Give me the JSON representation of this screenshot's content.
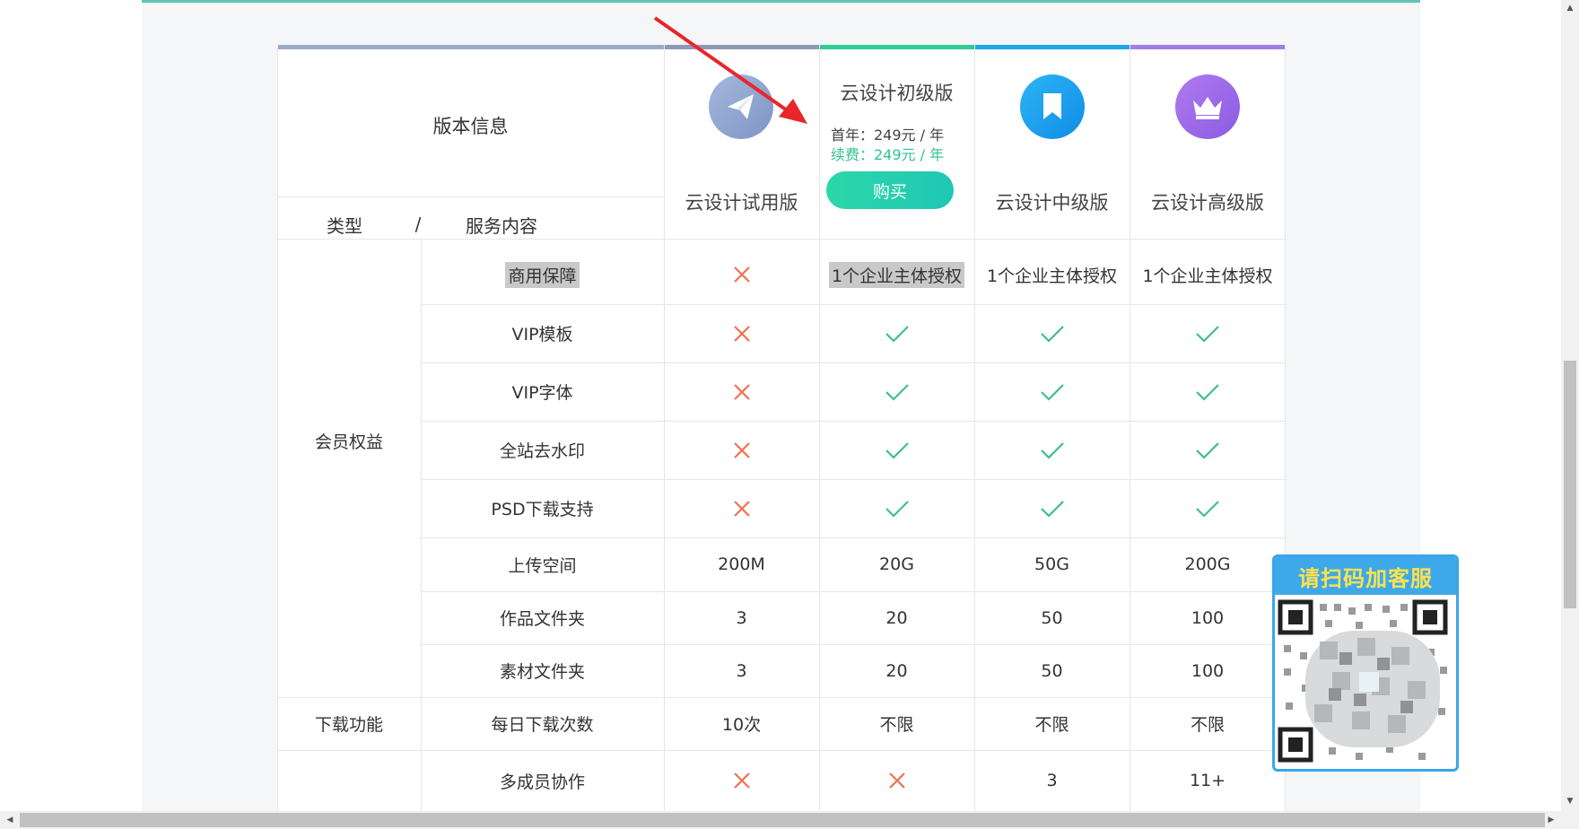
{
  "header": {
    "version_info": "版本信息",
    "type_label": "类型",
    "slash": "/",
    "service_label": "服务内容"
  },
  "plans": [
    {
      "name": "云设计试用版",
      "icon": "paper-plane-icon",
      "color": "#8fa8d6"
    },
    {
      "name": "云设计初级版",
      "first_year": "首年：249元 / 年",
      "renew": "续费：249元 / 年",
      "buy": "购买",
      "color": "#2ecc9a"
    },
    {
      "name": "云设计中级版",
      "icon": "bookmark-icon",
      "color": "#1aa0f0"
    },
    {
      "name": "云设计高级版",
      "icon": "crown-icon",
      "color": "#9b6ae8"
    }
  ],
  "groups": {
    "membership": "会员权益",
    "download": "下载功能"
  },
  "rows": [
    {
      "label": "商用保障",
      "values": [
        "x",
        "1个企业主体授权",
        "1个企业主体授权",
        "1个企业主体授权"
      ]
    },
    {
      "label": "VIP模板",
      "values": [
        "x",
        "check",
        "check",
        "check"
      ]
    },
    {
      "label": "VIP字体",
      "values": [
        "x",
        "check",
        "check",
        "check"
      ]
    },
    {
      "label": "全站去水印",
      "values": [
        "x",
        "check",
        "check",
        "check"
      ]
    },
    {
      "label": "PSD下载支持",
      "values": [
        "x",
        "check",
        "check",
        "check"
      ]
    },
    {
      "label": "上传空间",
      "values": [
        "200M",
        "20G",
        "50G",
        "200G"
      ]
    },
    {
      "label": "作品文件夹",
      "values": [
        "3",
        "20",
        "50",
        "100"
      ]
    },
    {
      "label": "素材文件夹",
      "values": [
        "3",
        "20",
        "50",
        "100"
      ]
    },
    {
      "label": "每日下载次数",
      "values": [
        "10次",
        "不限",
        "不限",
        "不限"
      ]
    },
    {
      "label": "多成员协作",
      "values": [
        "x",
        "x",
        "3",
        "11+"
      ]
    }
  ],
  "qr": {
    "title": "请扫码加客服"
  },
  "colors": {
    "cross": "#f07050",
    "check": "#3ec08a",
    "arrow": "#e8262a"
  }
}
